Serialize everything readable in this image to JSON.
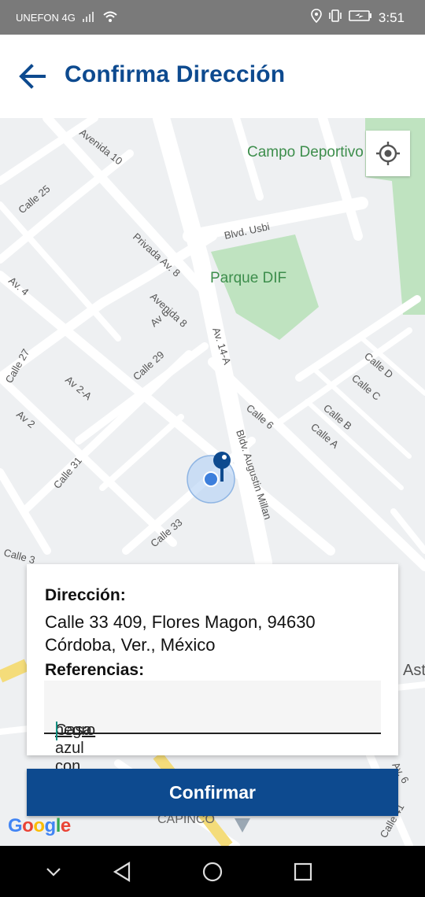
{
  "statusbar": {
    "carrier": "UNEFON 4G",
    "time": "3:51"
  },
  "header": {
    "title": "Confirma Dirección"
  },
  "map": {
    "labels": {
      "campo": "Campo Deportivo",
      "parque": "Parque DIF",
      "usbi": "Blvd. Usbi",
      "av10": "Avenida 10",
      "calle25": "Calle 25",
      "privada": "Privada Av. 8",
      "av4": "Av. 4",
      "av8": "Avenida 8",
      "av14a": "Av. 14-A",
      "calle27": "Calle 27",
      "av6": "Av 6",
      "calle29": "Calle 29",
      "av2a": "Av 2-A",
      "av2": "Av 2",
      "calle31": "Calle 31",
      "calle6": "Calle 6",
      "augustin": "Bldv. Augustin Millan",
      "calle33": "Calle 33",
      "calle3": "Calle 3",
      "called": "Calle D",
      "callec": "Calle C",
      "calleb": "Calle B",
      "callea": "Calle A",
      "calle41": "Calle 41",
      "ast": "Ast",
      "av6b": "Av. 6",
      "capinco": "CAPINCO"
    }
  },
  "card": {
    "direccion_label": "Dirección:",
    "address_line1": "Calle 33 409, Flores Magon, 94630",
    "address_line2": "Córdoba, Ver., México",
    "referencias_label": "Referencias:",
    "referencias_prefix": "Casa azul con ",
    "referencias_last": "negro"
  },
  "actions": {
    "confirm_label": "Confirmar"
  },
  "attribution": {
    "google_letters": [
      "G",
      "o",
      "o",
      "g",
      "l",
      "e"
    ],
    "google_colors": [
      "#4285F4",
      "#EA4335",
      "#FBBC05",
      "#4285F4",
      "#34A853",
      "#EA4335"
    ]
  },
  "colors": {
    "brand": "#0d4a8f",
    "park": "#bfe3c0",
    "map_bg": "#eef0f2"
  }
}
